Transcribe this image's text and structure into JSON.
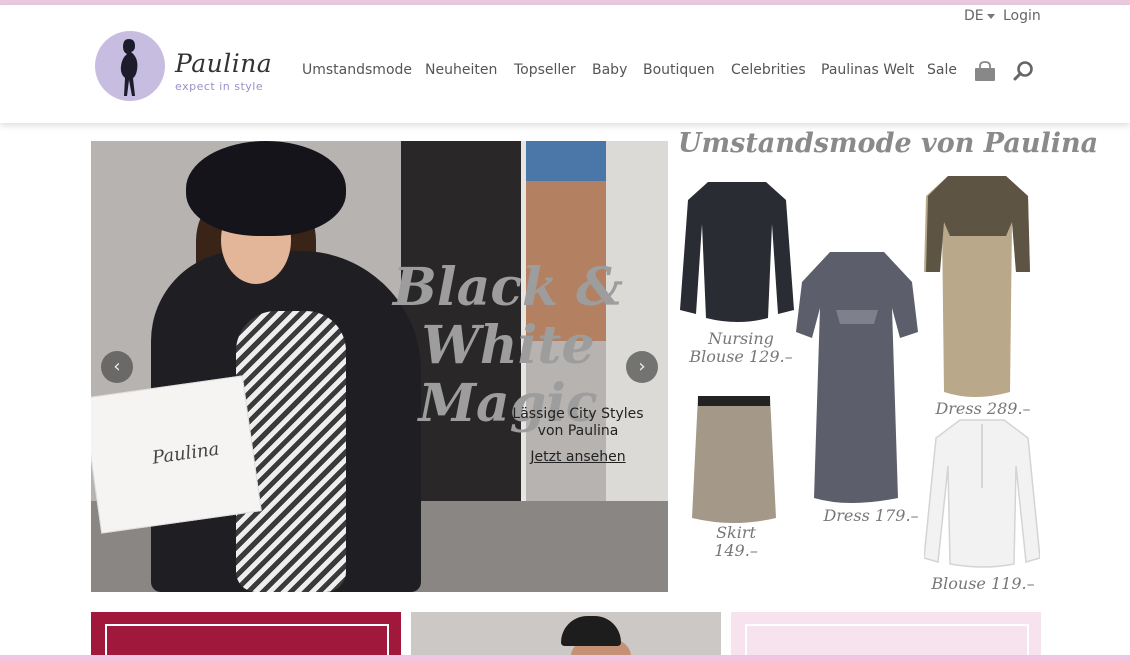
{
  "header": {
    "language": "DE",
    "login": "Login",
    "logo": {
      "name": "Paulina",
      "tagline": "expect in style"
    },
    "nav": [
      "Umstandsmode",
      "Neuheiten",
      "Topseller",
      "Baby",
      "Boutiquen",
      "Celebrities",
      "Paulinas Welt",
      "Sale"
    ]
  },
  "hero": {
    "headline_line1": "Black &",
    "headline_line2": "White Magic",
    "subtitle_line1": "Lässige City Styles",
    "subtitle_line2": "von Paulina",
    "cta": "Jetzt ansehen",
    "bag_logo": "Paulina"
  },
  "collage": {
    "title": "Umstandsmode von Paulina",
    "items": [
      {
        "line1": "Nursing",
        "line2": "Blouse 129.–"
      },
      {
        "line1": "Dress 179.–",
        "line2": ""
      },
      {
        "line1": "Dress 289.–",
        "line2": ""
      },
      {
        "line1": "Skirt",
        "line2": "149.–"
      },
      {
        "line1": "Blouse 119.–",
        "line2": ""
      }
    ]
  },
  "colors": {
    "accent": "#c7bde0",
    "tile_red": "#a0183c",
    "tile_pink": "#f7e3ee",
    "strip": "#f1c5df"
  }
}
